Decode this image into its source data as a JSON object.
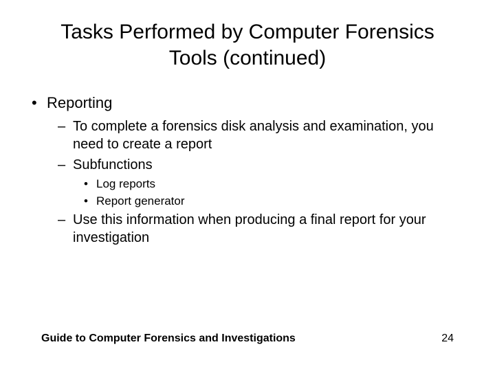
{
  "title": "Tasks Performed by Computer Forensics Tools (continued)",
  "bullets": {
    "l1": "Reporting",
    "l2a": "To complete a forensics disk analysis and examination, you need to create a report",
    "l2b": "Subfunctions",
    "l3a": "Log reports",
    "l3b": "Report generator",
    "l2c": "Use this information when producing a final report for your investigation"
  },
  "footer": {
    "left": "Guide to Computer Forensics and Investigations",
    "right": "24"
  }
}
